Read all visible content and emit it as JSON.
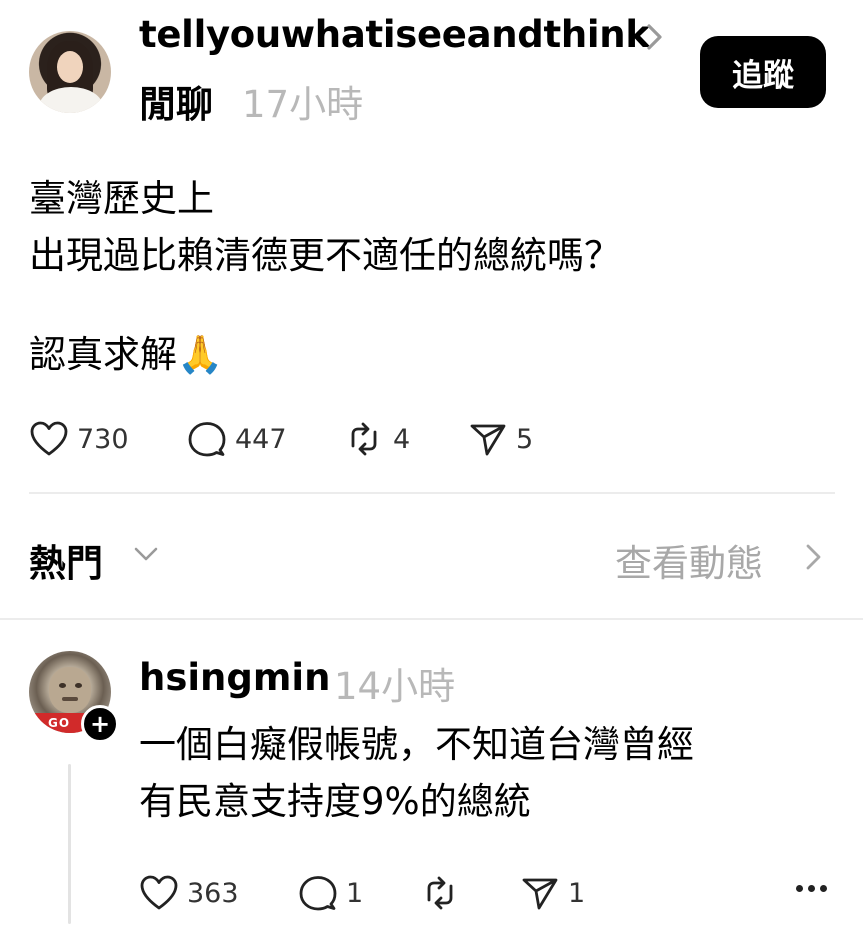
{
  "post": {
    "author": "tellyouwhatiseeandthink",
    "topic": "閒聊",
    "time": "17小時",
    "follow_label": "追蹤",
    "body_lines": [
      "臺灣歷史上",
      "出現過比賴清德更不適任的總統嗎？"
    ],
    "body_tail": "認真求解🙏",
    "stats": {
      "likes": "730",
      "comments": "447",
      "reposts": "4",
      "shares": "5"
    }
  },
  "sort_bar": {
    "sort_label": "熱門",
    "view_activity_label": "查看動態"
  },
  "reply": {
    "author": "hsingmin",
    "time": "14小時",
    "avatar_tag": "GO",
    "add_badge": "+",
    "body_lines": [
      "一個白癡假帳號，不知道台灣曾經",
      "有民意支持度9%的總統"
    ],
    "stats": {
      "likes": "363",
      "comments": "1",
      "shares": "1"
    }
  },
  "icons": [
    "avatar",
    "chevron-right-icon",
    "heart-icon",
    "comment-icon",
    "repost-icon",
    "share-icon",
    "chevron-down-icon",
    "more-icon",
    "plus-icon"
  ]
}
